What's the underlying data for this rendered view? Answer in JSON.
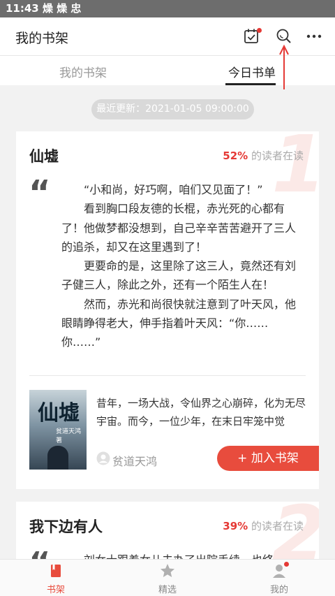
{
  "status_bar": {
    "time": "11:43 燥 燥 忠"
  },
  "header": {
    "title": "我的书架"
  },
  "icons": {
    "checkin": "calendar-check-icon",
    "search": "search-icon",
    "more": "more-dots-icon"
  },
  "tabs": {
    "inactive": "我的书架",
    "active": "今日书单"
  },
  "update": {
    "text": "最近更新：2021-01-05 09:00:00"
  },
  "colors": {
    "accent": "#e84c3d",
    "pct": "#e53935"
  },
  "books": [
    {
      "rank": "1",
      "title": "仙墟",
      "percent": "52%",
      "reading_label": "的读者在读",
      "quote": "“",
      "excerpt": [
        "“小和尚，好巧啊，咱们又见面了！”",
        "看到胸口段友德的长棍，赤光死的心都有了！他做梦都没想到，自己辛辛苦苦避开了三人的追杀，却又在这里遇到了！",
        "更要命的是，这里除了这三人，竟然还有刘子健三人，除此之外，还有一个陌生人在！",
        "然而，赤光和尚很快就注意到了叶天风，他眼睛睁得老大，伸手指着叶天风：“你……你……”"
      ],
      "cover_title": "仙墟",
      "cover_subtitle": "贫道天鸿 著",
      "summary": "昔年，一场大战，令仙界之心崩碎，化为无尽宇宙。而今，一位少年，在末日牢笼中觉",
      "author": "贫道天鸿",
      "add_button": "+ 加入书架"
    },
    {
      "rank": "2",
      "title": "我下边有人",
      "percent": "39%",
      "reading_label": "的读者在读",
      "quote": "“",
      "excerpt": [
        "刘女士跟着女儿去办了出院手续，也终"
      ]
    }
  ],
  "bottom_nav": [
    {
      "label": "书架",
      "icon": "bookshelf-icon"
    },
    {
      "label": "精选",
      "icon": "star-icon"
    },
    {
      "label": "我的",
      "icon": "profile-icon"
    }
  ]
}
